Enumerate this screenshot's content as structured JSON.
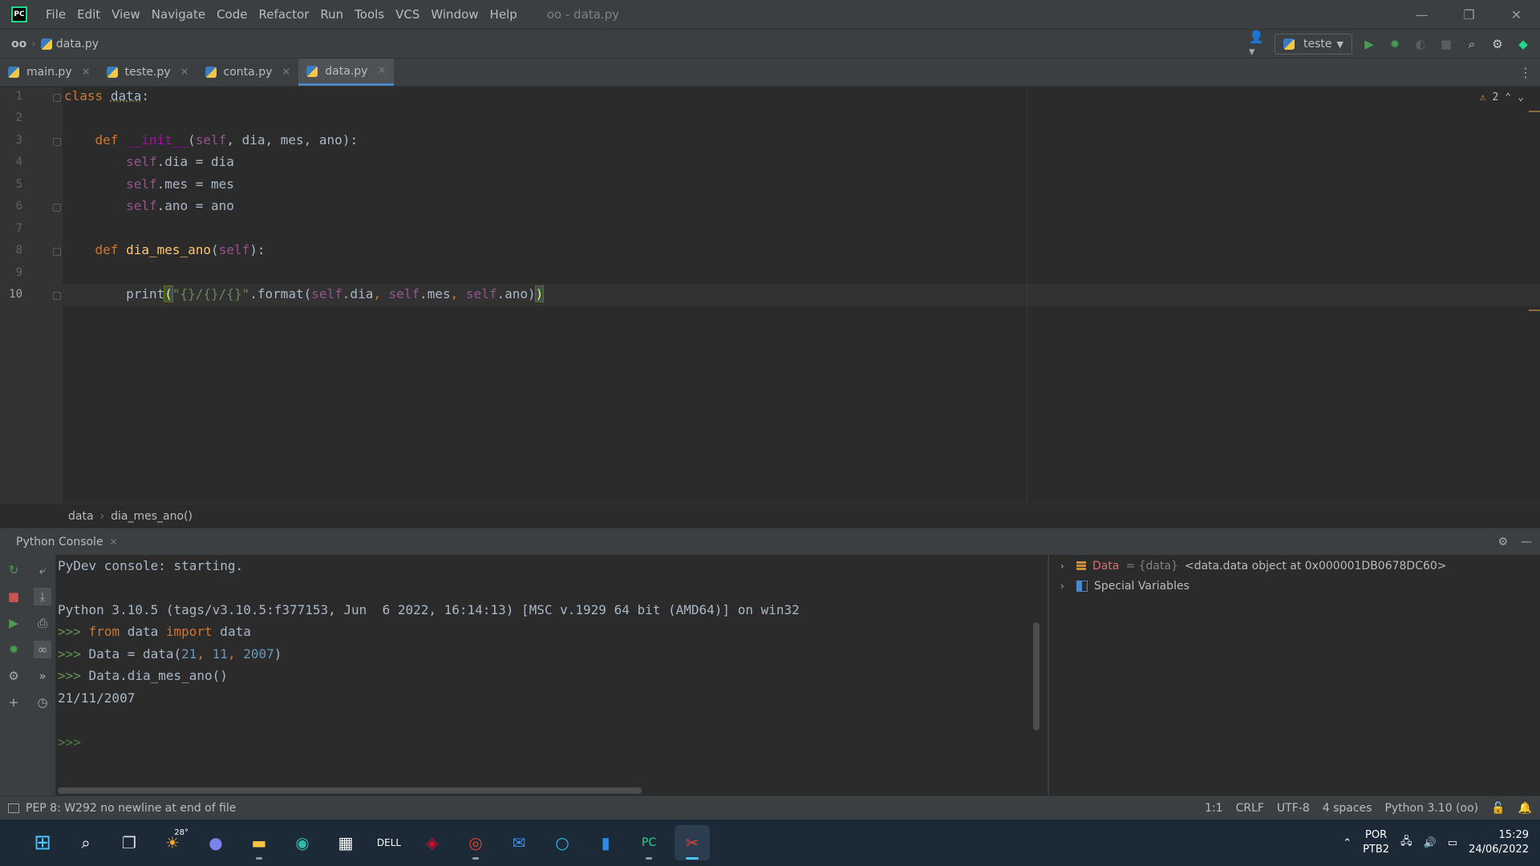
{
  "window": {
    "app_icon": "pycharm-icon",
    "title": "oo - data.py",
    "menu": [
      "File",
      "Edit",
      "View",
      "Navigate",
      "Code",
      "Refactor",
      "Run",
      "Tools",
      "VCS",
      "Window",
      "Help"
    ],
    "controls": [
      "minimize-icon",
      "restore-icon",
      "close-icon"
    ]
  },
  "navbar": {
    "project": "oo",
    "file": "data.py",
    "run_config": "teste"
  },
  "tabs": [
    {
      "label": "main.py",
      "active": false
    },
    {
      "label": "teste.py",
      "active": false
    },
    {
      "label": "conta.py",
      "active": false
    },
    {
      "label": "data.py",
      "active": true
    }
  ],
  "editor": {
    "warnings_count": "2",
    "line_numbers": [
      "1",
      "2",
      "3",
      "4",
      "5",
      "6",
      "7",
      "8",
      "9",
      "10"
    ],
    "current_line": "10",
    "code_text": {
      "kw_class": "class",
      "class_name": "data",
      "kw_def": "def",
      "init_name": "__init__",
      "self": "self",
      "params_init": ", dia, mes, ano",
      "attr_dia": ".dia = dia",
      "attr_mes": ".mes = mes",
      "attr_ano": ".ano = ano",
      "method_name": "dia_mes_ano",
      "print_fn": "print",
      "fmt_string": "\"{}/{}/{}\"",
      "format_call": ".format(",
      "dia": ".dia",
      "mes": ".mes",
      "ano": ".ano"
    }
  },
  "breadcrumbs": [
    "data",
    "dia_mes_ano()"
  ],
  "console": {
    "title": "Python Console",
    "lines": {
      "l1": "PyDev console: starting.",
      "l2": "Python 3.10.5 (tags/v3.10.5:f377153, Jun  6 2022, 16:14:13) [MSC v.1929 64 bit (AMD64)] on win32",
      "prompt": ">>>",
      "cmd1_from": "from",
      "cmd1_mid": " data ",
      "cmd1_import": "import",
      "cmd1_end": " data",
      "cmd2_start": " Data = data(",
      "cmd2_n1": "21",
      "cmd2_n2": "11",
      "cmd2_n3": "2007",
      "cmd3": " Data.dia_mes_ano()",
      "output": "21/11/2007"
    }
  },
  "variables": {
    "data_name": "Data",
    "data_type": " = {data} ",
    "data_value": "<data.data object at 0x000001DB0678DC60>",
    "special": "Special Variables"
  },
  "statusbar": {
    "message": "PEP 8: W292 no newline at end of file",
    "position": "1:1",
    "line_sep": "CRLF",
    "encoding": "UTF-8",
    "indent": "4 spaces",
    "interpreter": "Python 3.10 (oo)"
  },
  "taskbar": {
    "weather": "28°",
    "lang1": "POR",
    "lang2": "PTB2",
    "time": "15:29",
    "date": "24/06/2022"
  },
  "colors": {
    "accent": "#4a88c7",
    "keyword": "#cc7832",
    "self": "#94558d",
    "function": "#ffc66d",
    "string": "#6a8759",
    "number": "#6897bb"
  }
}
